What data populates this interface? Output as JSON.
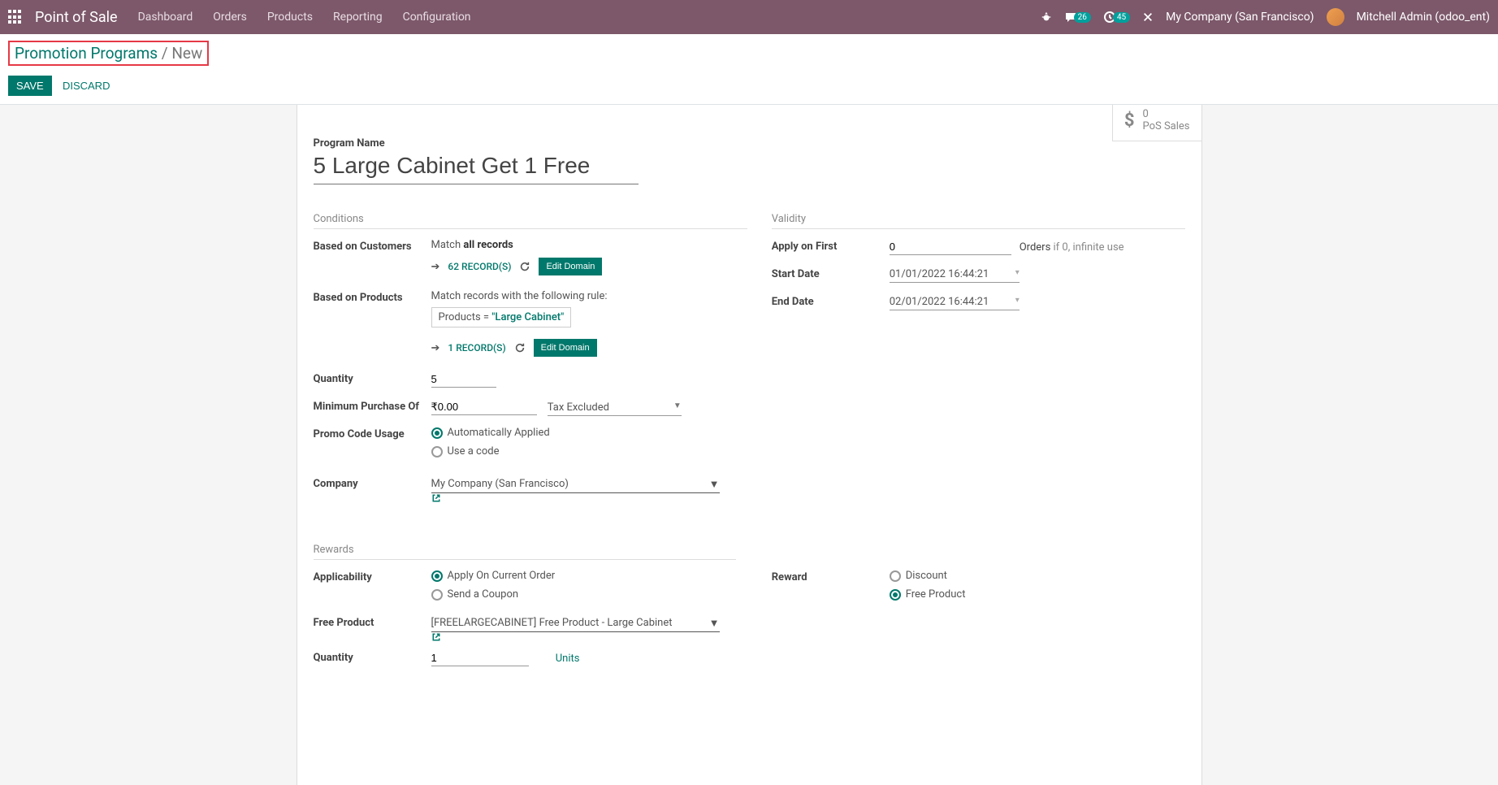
{
  "topbar": {
    "app_title": "Point of Sale",
    "menu": [
      "Dashboard",
      "Orders",
      "Products",
      "Reporting",
      "Configuration"
    ],
    "messages_badge": "26",
    "activity_badge": "45",
    "company": "My Company (San Francisco)",
    "user": "Mitchell Admin (odoo_ent)"
  },
  "controlbar": {
    "breadcrumb_root": "Promotion Programs",
    "breadcrumb_sep": " / ",
    "breadcrumb_current": "New",
    "save": "Save",
    "discard": "Discard"
  },
  "statbox": {
    "count": "0",
    "label": "PoS Sales"
  },
  "form": {
    "program_name_label": "Program Name",
    "program_name": "5 Large Cabinet Get 1 Free",
    "sections": {
      "conditions": "Conditions",
      "validity": "Validity",
      "rewards": "Rewards"
    },
    "labels": {
      "based_on_customers": "Based on Customers",
      "based_on_products": "Based on Products",
      "quantity": "Quantity",
      "min_purchase": "Minimum Purchase Of",
      "promo_code_usage": "Promo Code Usage",
      "company": "Company",
      "apply_on_first": "Apply on First",
      "start_date": "Start Date",
      "end_date": "End Date",
      "applicability": "Applicability",
      "reward": "Reward",
      "free_product": "Free Product",
      "reward_quantity": "Quantity"
    },
    "customers": {
      "match_prefix": "Match ",
      "match_bold": "all records",
      "records": "62 record(s)",
      "edit_domain": "Edit Domain"
    },
    "products": {
      "match_text": "Match records with the following rule:",
      "rule_field": "Products",
      "rule_eq": " = ",
      "rule_value": "\"Large Cabinet\"",
      "records": "1 record(s)",
      "edit_domain": "Edit Domain"
    },
    "quantity": "5",
    "min_purchase_amount": "₹0.00",
    "tax_option": "Tax Excluded",
    "promo_code": {
      "auto": "Automatically Applied",
      "code": "Use a code"
    },
    "company_value": "My Company (San Francisco)",
    "apply_on_first_value": "0",
    "apply_on_first_label": "Orders",
    "apply_on_first_help": " if 0, infinite use",
    "start_date_value": "01/01/2022 16:44:21",
    "end_date_value": "02/01/2022 16:44:21",
    "applicability": {
      "current": "Apply On Current Order",
      "coupon": "Send a Coupon"
    },
    "reward": {
      "discount": "Discount",
      "free_product": "Free Product"
    },
    "free_product_value": "[FREELARGECABINET] Free Product - Large Cabinet",
    "reward_quantity_value": "1",
    "reward_quantity_units": "Units"
  }
}
